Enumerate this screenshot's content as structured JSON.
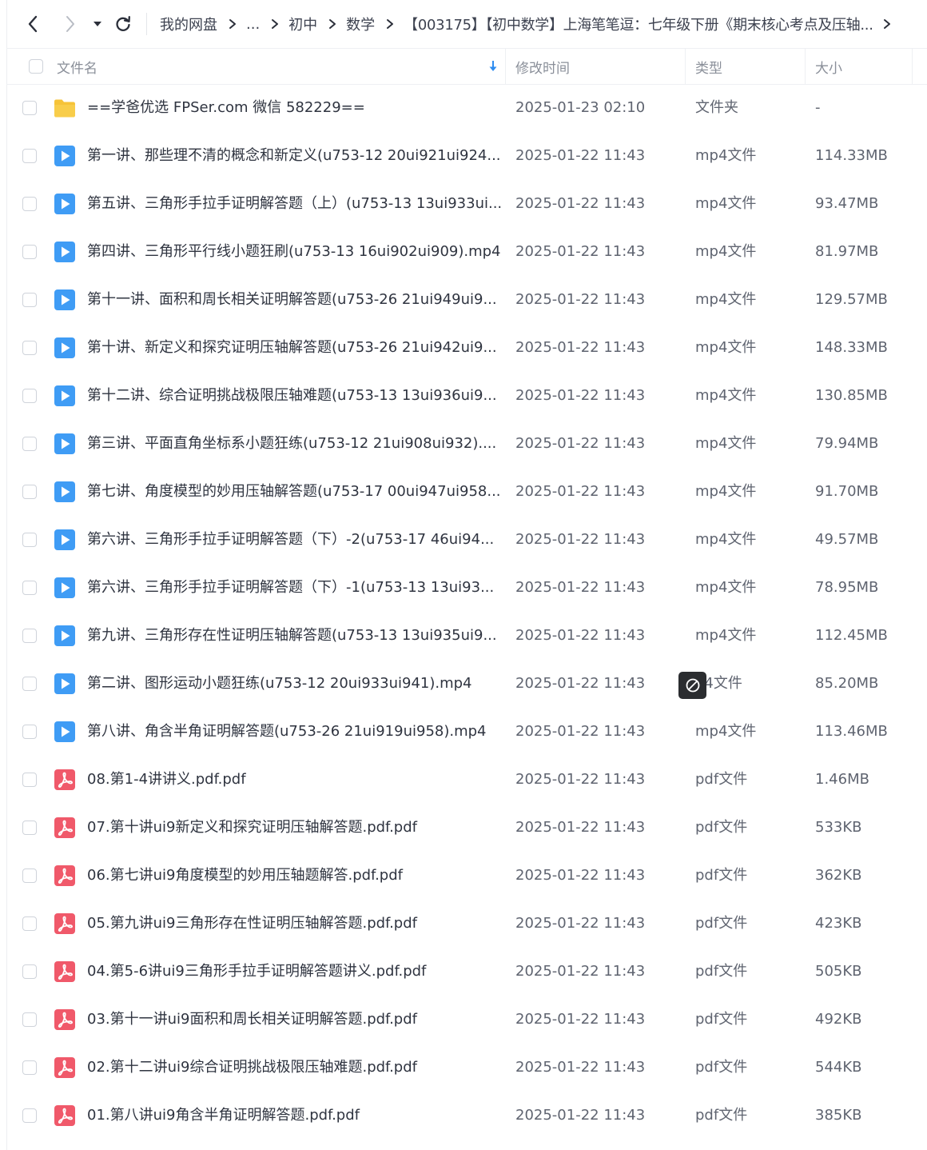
{
  "breadcrumb": {
    "items": [
      "我的网盘",
      "...",
      "初中",
      "数学",
      "【003175】【初中数学】上海笔笔逗：七年级下册《期末核心考点及压轴..."
    ]
  },
  "header": {
    "name": "文件名",
    "time": "修改时间",
    "type": "类型",
    "size": "大小"
  },
  "icons": {
    "back": "chevron-left-icon",
    "forward": "chevron-right-icon",
    "dropdown": "caret-down-icon",
    "refresh": "refresh-icon",
    "sort": "sort-down-arrow-icon",
    "folder": "folder-icon",
    "video": "video-file-icon",
    "pdf": "pdf-file-icon",
    "forbidden": "forbidden-icon"
  },
  "colors": {
    "folder": "#f6c338",
    "video": "#3f9cf5",
    "pdf": "#f0596a",
    "sort_arrow": "#2e8cf0",
    "tooltip_bg": "#2b2d30"
  },
  "files": [
    {
      "icon": "folder",
      "name": "==学爸优选 FPSer.com 微信 582229==",
      "time": "2025-01-23 02:10",
      "type": "文件夹",
      "size": "-"
    },
    {
      "icon": "video",
      "name": "第一讲、那些理不清的概念和新定义(u753-12 20ui921ui924...",
      "time": "2025-01-22 11:43",
      "type": "mp4文件",
      "size": "114.33MB"
    },
    {
      "icon": "video",
      "name": "第五讲、三角形手拉手证明解答题（上）(u753-13 13ui933ui...",
      "time": "2025-01-22 11:43",
      "type": "mp4文件",
      "size": "93.47MB"
    },
    {
      "icon": "video",
      "name": "第四讲、三角形平行线小题狂刷(u753-13 16ui902ui909).mp4",
      "time": "2025-01-22 11:43",
      "type": "mp4文件",
      "size": "81.97MB"
    },
    {
      "icon": "video",
      "name": "第十一讲、面积和周长相关证明解答题(u753-26 21ui949ui9...",
      "time": "2025-01-22 11:43",
      "type": "mp4文件",
      "size": "129.57MB"
    },
    {
      "icon": "video",
      "name": "第十讲、新定义和探究证明压轴解答题(u753-26 21ui942ui9...",
      "time": "2025-01-22 11:43",
      "type": "mp4文件",
      "size": "148.33MB"
    },
    {
      "icon": "video",
      "name": "第十二讲、综合证明挑战极限压轴难题(u753-13 13ui936ui9...",
      "time": "2025-01-22 11:43",
      "type": "mp4文件",
      "size": "130.85MB"
    },
    {
      "icon": "video",
      "name": "第三讲、平面直角坐标系小题狂练(u753-12 21ui908ui932)....",
      "time": "2025-01-22 11:43",
      "type": "mp4文件",
      "size": "79.94MB"
    },
    {
      "icon": "video",
      "name": "第七讲、角度模型的妙用压轴解答题(u753-17 00ui947ui958...",
      "time": "2025-01-22 11:43",
      "type": "mp4文件",
      "size": "91.70MB"
    },
    {
      "icon": "video",
      "name": "第六讲、三角形手拉手证明解答题（下）-2(u753-17 46ui94...",
      "time": "2025-01-22 11:43",
      "type": "mp4文件",
      "size": "49.57MB"
    },
    {
      "icon": "video",
      "name": "第六讲、三角形手拉手证明解答题（下）-1(u753-13 13ui93...",
      "time": "2025-01-22 11:43",
      "type": "mp4文件",
      "size": "78.95MB"
    },
    {
      "icon": "video",
      "name": "第九讲、三角形存在性证明压轴解答题(u753-13 13ui935ui9...",
      "time": "2025-01-22 11:43",
      "type": "mp4文件",
      "size": "112.45MB"
    },
    {
      "icon": "video",
      "name": "第二讲、图形运动小题狂练(u753-12 20ui933ui941).mp4",
      "time": "2025-01-22 11:43",
      "type": "p4文件",
      "size": "85.20MB"
    },
    {
      "icon": "video",
      "name": "第八讲、角含半角证明解答题(u753-26 21ui919ui958).mp4",
      "time": "2025-01-22 11:43",
      "type": "mp4文件",
      "size": "113.46MB"
    },
    {
      "icon": "pdf",
      "name": "08.第1-4讲讲义.pdf.pdf",
      "time": "2025-01-22 11:43",
      "type": "pdf文件",
      "size": "1.46MB"
    },
    {
      "icon": "pdf",
      "name": "07.第十讲ui9新定义和探究证明压轴解答题.pdf.pdf",
      "time": "2025-01-22 11:43",
      "type": "pdf文件",
      "size": "533KB"
    },
    {
      "icon": "pdf",
      "name": "06.第七讲ui9角度模型的妙用压轴题解答.pdf.pdf",
      "time": "2025-01-22 11:43",
      "type": "pdf文件",
      "size": "362KB"
    },
    {
      "icon": "pdf",
      "name": "05.第九讲ui9三角形存在性证明压轴解答题.pdf.pdf",
      "time": "2025-01-22 11:43",
      "type": "pdf文件",
      "size": "423KB"
    },
    {
      "icon": "pdf",
      "name": "04.第5-6讲ui9三角形手拉手证明解答题讲义.pdf.pdf",
      "time": "2025-01-22 11:43",
      "type": "pdf文件",
      "size": "505KB"
    },
    {
      "icon": "pdf",
      "name": "03.第十一讲ui9面积和周长相关证明解答题.pdf.pdf",
      "time": "2025-01-22 11:43",
      "type": "pdf文件",
      "size": "492KB"
    },
    {
      "icon": "pdf",
      "name": "02.第十二讲ui9综合证明挑战极限压轴难题.pdf.pdf",
      "time": "2025-01-22 11:43",
      "type": "pdf文件",
      "size": "544KB"
    },
    {
      "icon": "pdf",
      "name": "01.第八讲ui9角含半角证明解答题.pdf.pdf",
      "time": "2025-01-22 11:43",
      "type": "pdf文件",
      "size": "385KB"
    }
  ]
}
